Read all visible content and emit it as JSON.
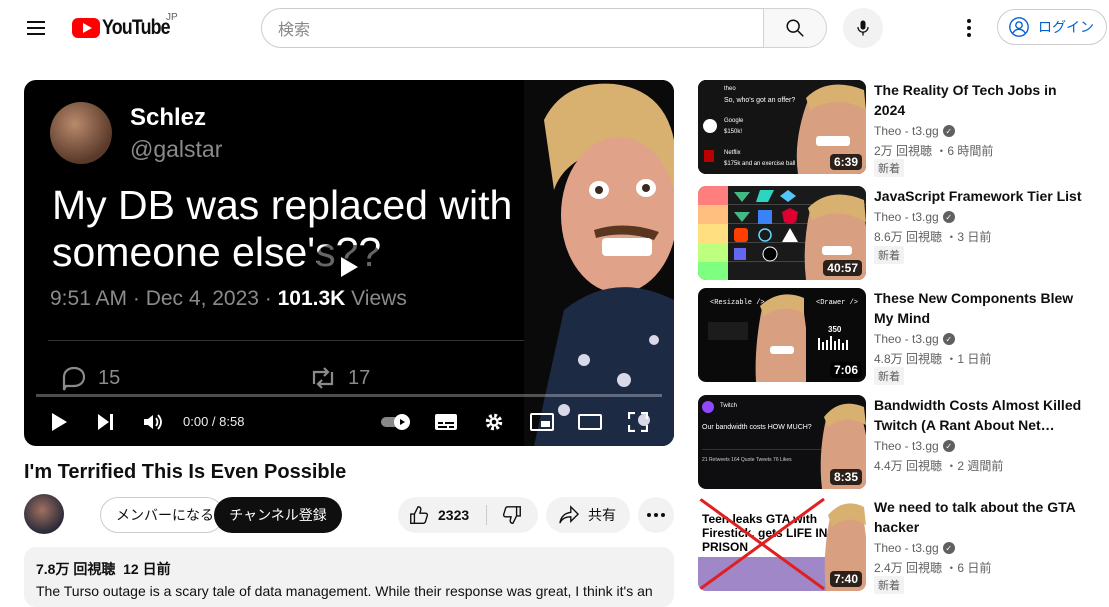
{
  "header": {
    "logo_text": "YouTube",
    "logo_region": "JP",
    "search_placeholder": "検索",
    "login_label": "ログイン"
  },
  "player": {
    "tweet_name": "Schlez",
    "tweet_handle": "@galstar",
    "tweet_text": "My DB was replaced with someone else's??",
    "tweet_time": "9:51 AM · Dec 4, 2023 · ",
    "tweet_views_count": "101.3K",
    "tweet_views_label": " Views",
    "tweet_replies": "15",
    "tweet_retweets": "17",
    "time_display": "0:00 / 8:58"
  },
  "video": {
    "title": "I'm Terrified This Is Even Possible",
    "member_label": "メンバーになる",
    "subscribe_label": "チャンネル登録",
    "like_count": "2323",
    "share_label": "共有",
    "views": "7.8万 回視聴",
    "date": "12 日前",
    "description": "The Turso outage is a scary tale of data management. While their response was great, I think it's an"
  },
  "related": [
    {
      "title": "The Reality Of Tech Jobs in 2024",
      "channel": "Theo - t3.gg",
      "meta": "2万 回視聴 ・6 時間前",
      "badge": "新着",
      "duration": "6:39"
    },
    {
      "title": "JavaScript Framework Tier List",
      "channel": "Theo - t3.gg",
      "meta": "8.6万 回視聴 ・3 日前",
      "badge": "新着",
      "duration": "40:57"
    },
    {
      "title": "These New Components Blew My Mind",
      "channel": "Theo - t3.gg",
      "meta": "4.8万 回視聴 ・1 日前",
      "badge": "新着",
      "duration": "7:06"
    },
    {
      "title": "Bandwidth Costs Almost Killed Twitch (A Rant About Net…",
      "channel": "Theo - t3.gg",
      "meta": "4.4万 回視聴 ・2 週間前",
      "badge": "",
      "duration": "8:35"
    },
    {
      "title": "We need to talk about the GTA hacker",
      "channel": "Theo - t3.gg",
      "meta": "2.4万 回視聴 ・6 日前",
      "badge": "新着",
      "duration": "7:40"
    }
  ],
  "thumbs": {
    "t1_lines": [
      "theo",
      "So, who's got an offer?",
      "Google",
      "$150k!",
      "Netflix",
      "$175k and an exercise ball"
    ],
    "t3_left": "<Resizable />",
    "t3_right": "<Drawer />",
    "t3_num": "350",
    "t4_head": "Twitch",
    "t4_text": "Our bandwidth costs HOW MUCH?",
    "t4_stats": "21 Retweets   164 Quote Tweets   76 Likes",
    "t5_text": "Teen leaks GTA with Firestick, gets LIFE IN PRISON"
  }
}
